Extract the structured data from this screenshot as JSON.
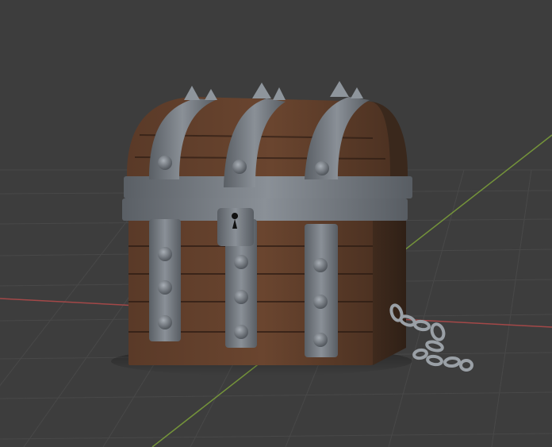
{
  "scene": {
    "subject": "treasure-chest",
    "background_color": "#3d3d3d",
    "grid_color": "#4a4a4a",
    "x_axis_color": "#b54a4a",
    "y_axis_color": "#7ea33a",
    "wood_color": "#5b3a27",
    "iron_color": "#6f747a",
    "chain_color": "#9aa0a6"
  }
}
